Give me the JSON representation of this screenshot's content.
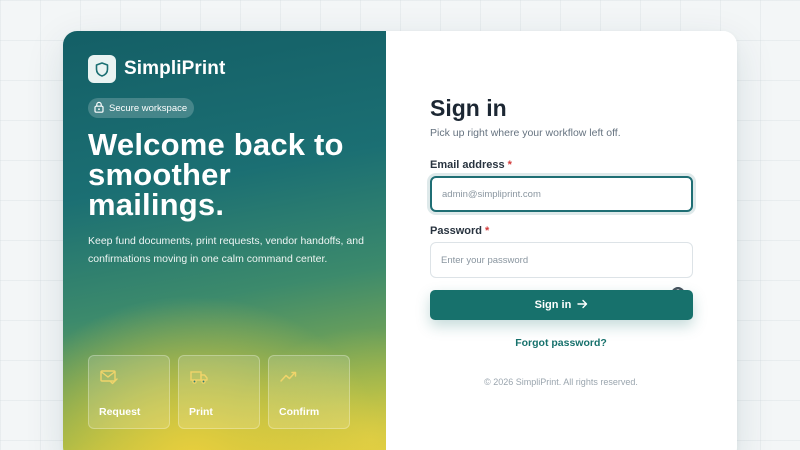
{
  "brand": {
    "name": "SimpliPrint",
    "logo_icon": "shield-icon"
  },
  "hero": {
    "badge": "Secure workspace",
    "badge_icon": "lock-icon",
    "title": "Welcome back to smoother mailings.",
    "subtitle": "Keep fund documents, print requests, vendor handoffs, and confirmations moving in one calm command center.",
    "features": [
      {
        "label": "Request",
        "icon": "mail-check-icon"
      },
      {
        "label": "Print",
        "icon": "truck-icon"
      },
      {
        "label": "Confirm",
        "icon": "trend-icon"
      }
    ]
  },
  "form": {
    "title": "Sign in",
    "subtitle": "Pick up right where your workflow left off.",
    "email": {
      "label": "Email address",
      "required": "*",
      "placeholder": "admin@simpliprint.com",
      "value": ""
    },
    "password": {
      "label": "Password",
      "required": "*",
      "placeholder": "Enter your password",
      "value": ""
    },
    "submit_label": "Sign in",
    "forgot_label": "Forgot password?",
    "copyright": "© 2026 SimpliPrint. All rights reserved."
  },
  "colors": {
    "accent": "#17716c",
    "required": "#d23a3a",
    "feature_icon": "#f0d46a"
  }
}
